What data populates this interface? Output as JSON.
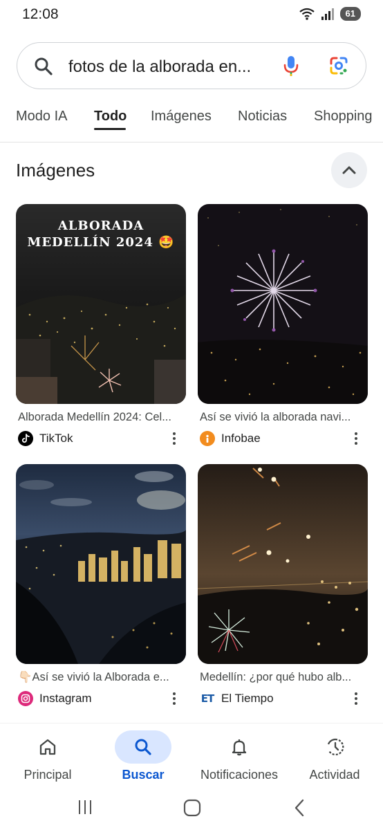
{
  "status_bar": {
    "time": "12:08",
    "battery": "61",
    "icons": [
      "wifi-icon",
      "signal-icon",
      "battery-icon"
    ]
  },
  "search": {
    "query": "fotos de la alborada en...",
    "icons": [
      "search-icon",
      "mic-icon",
      "google-lens-icon"
    ]
  },
  "tabs": [
    {
      "label": "Modo IA",
      "active": false
    },
    {
      "label": "Todo",
      "active": true
    },
    {
      "label": "Imágenes",
      "active": false
    },
    {
      "label": "Noticias",
      "active": false
    },
    {
      "label": "Shopping",
      "active": false
    }
  ],
  "section": {
    "title": "Imágenes",
    "collapse_icon": "chevron-up-icon"
  },
  "results": [
    {
      "thumb_text_1": "ALBORADA",
      "thumb_text_2": "MEDELLÍN 2024 🤩",
      "caption": "Alborada Medellín 2024: Cel...",
      "source": "TikTok",
      "source_icon": "tiktok-icon"
    },
    {
      "caption": "Así se vivió la alborada navi...",
      "source": "Infobae",
      "source_icon": "infobae-icon"
    },
    {
      "caption": "👇🏻Así se vivió la Alborada e...",
      "source": "Instagram",
      "source_icon": "instagram-icon"
    },
    {
      "caption": "Medellín: ¿por qué hubo alb...",
      "source": "El Tiempo",
      "source_icon": "el-tiempo-icon",
      "source_icon_text": "ET"
    }
  ],
  "bottom_nav": [
    {
      "label": "Principal",
      "icon": "home-icon",
      "active": false
    },
    {
      "label": "Buscar",
      "icon": "search-icon",
      "active": true
    },
    {
      "label": "Notificaciones",
      "icon": "bell-icon",
      "active": false
    },
    {
      "label": "Actividad",
      "icon": "activity-icon",
      "active": false
    }
  ],
  "colors": {
    "accent": "#0b57d0",
    "nav_active_bg": "#d9e6ff"
  }
}
